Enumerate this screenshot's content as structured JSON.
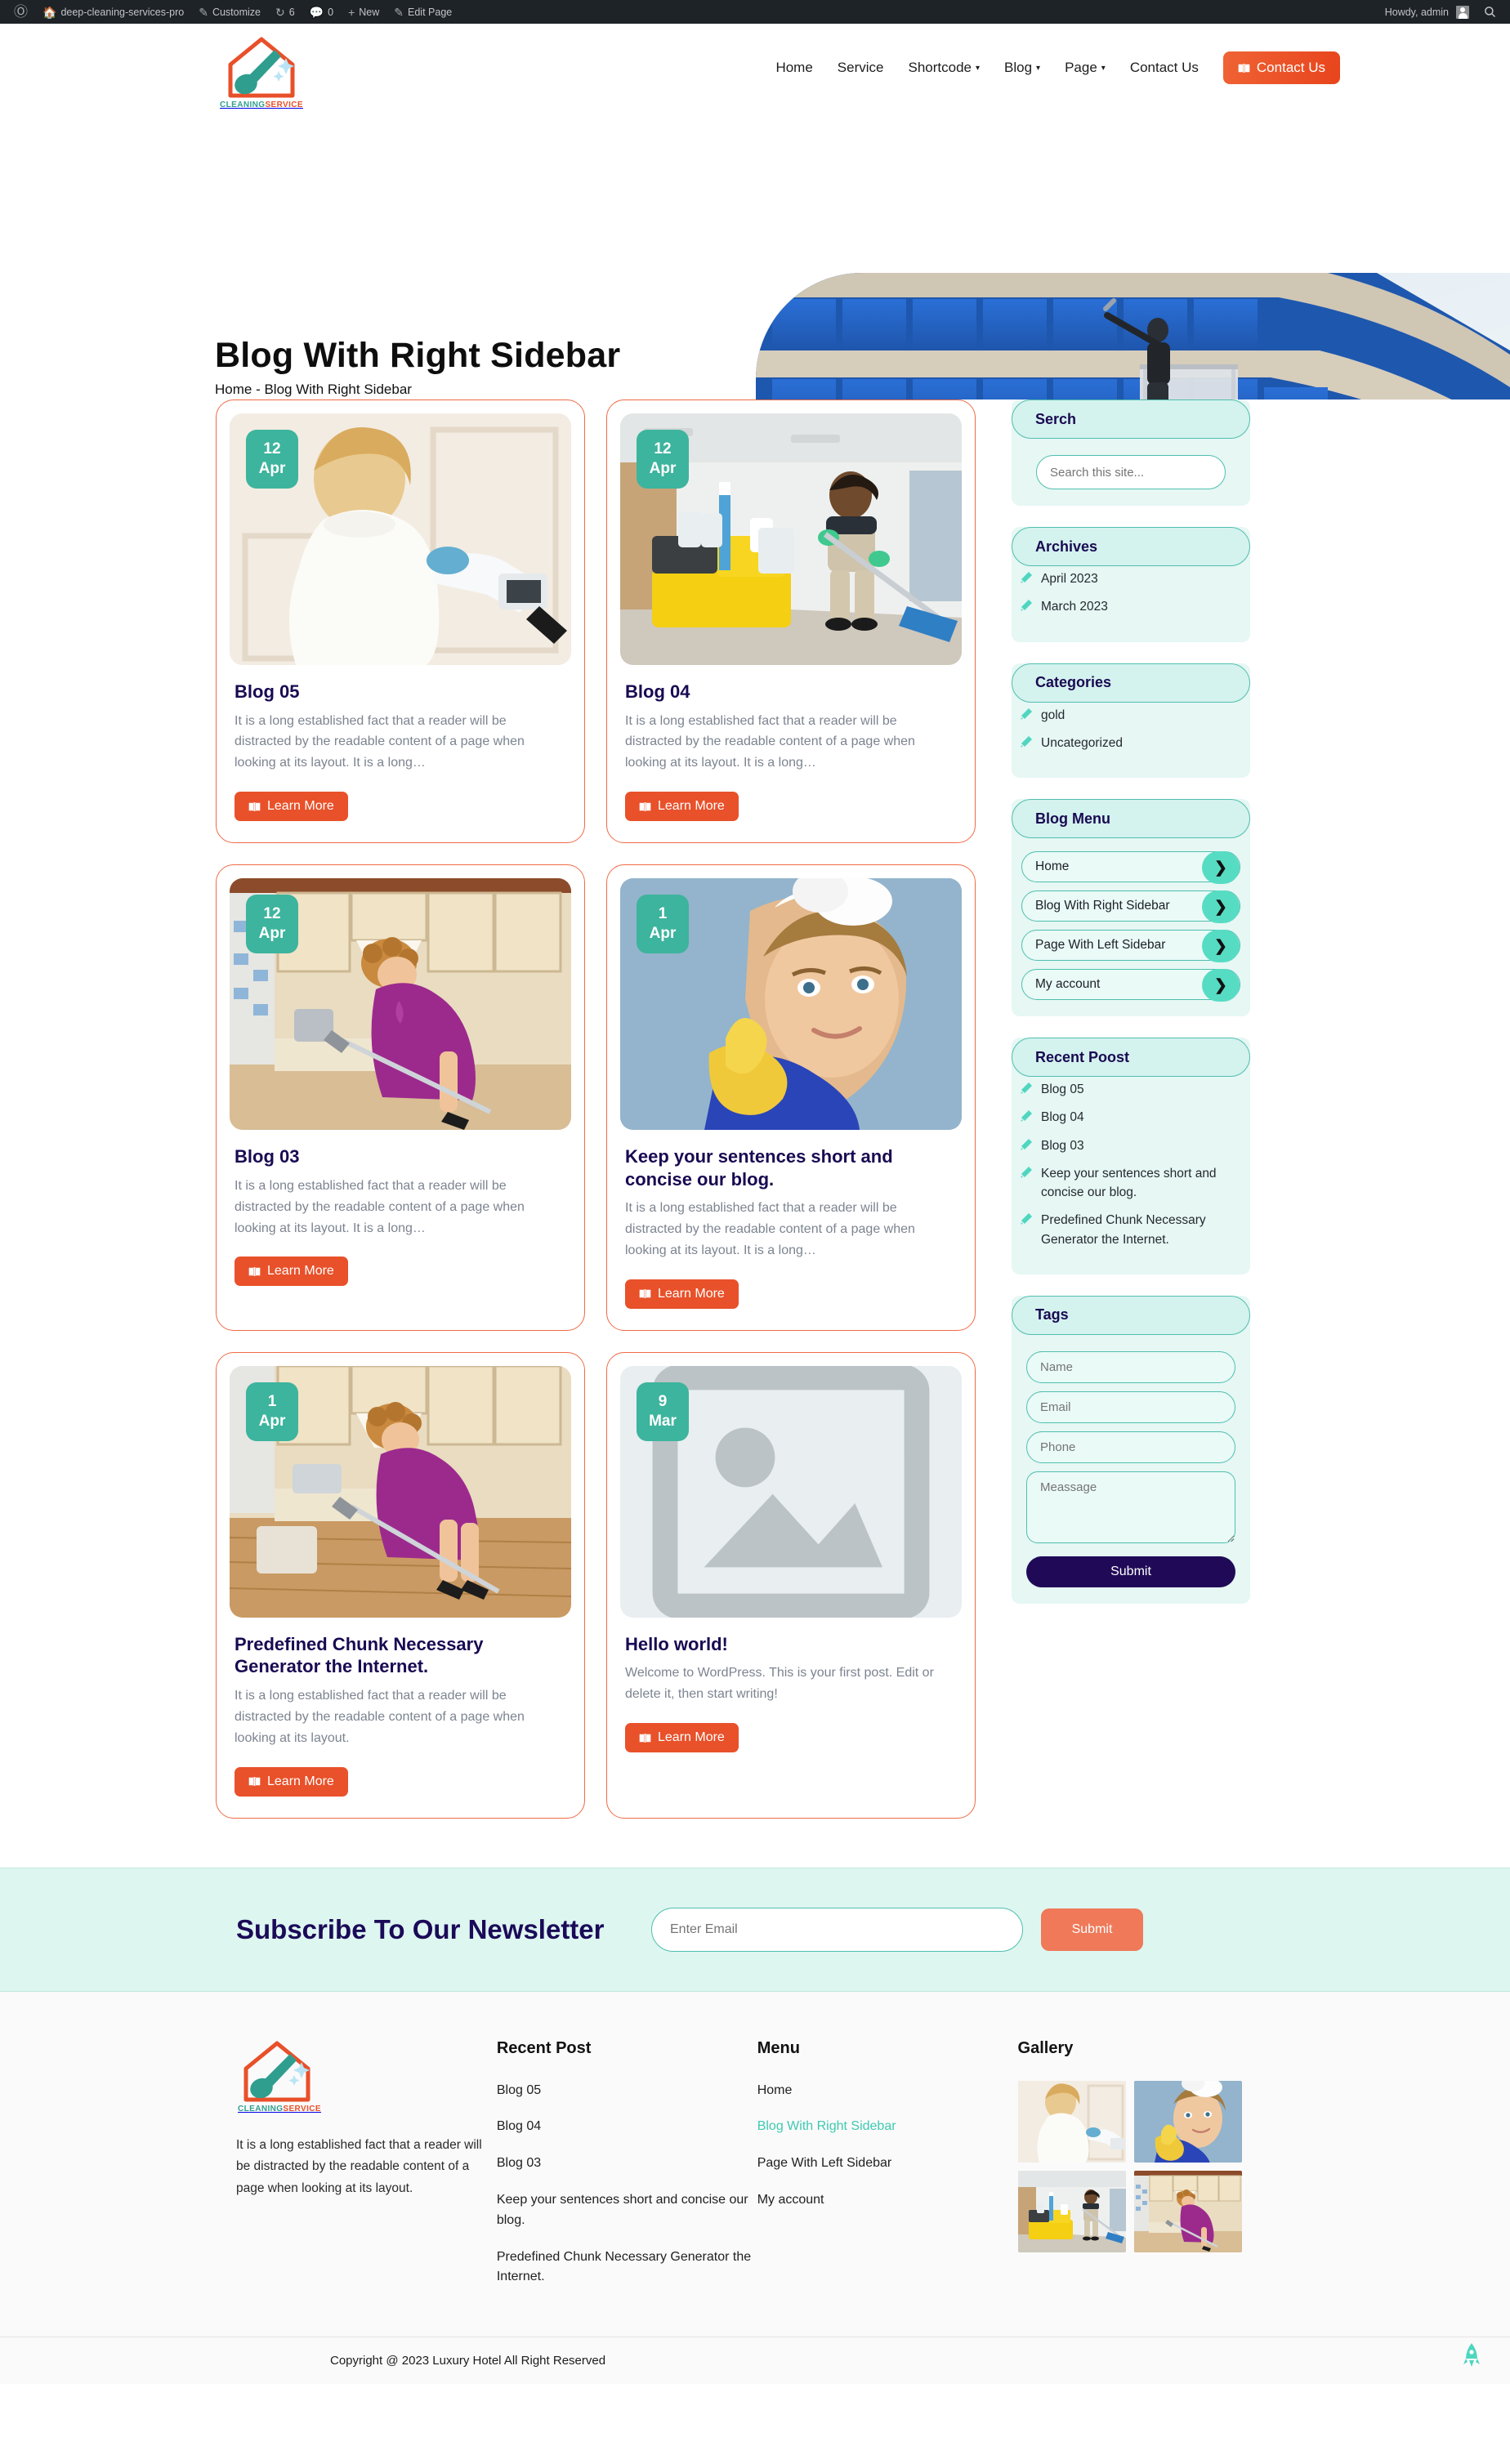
{
  "adminbar": {
    "site_name": "deep-cleaning-services-pro",
    "customize": "Customize",
    "updates_count": "6",
    "comments_count": "0",
    "new": "New",
    "edit_page": "Edit Page",
    "howdy": "Howdy, admin"
  },
  "brand": {
    "line1": "CLEANING",
    "line2": "SERVICE"
  },
  "nav": {
    "items": [
      {
        "label": "Home",
        "caret": false
      },
      {
        "label": "Service",
        "caret": false
      },
      {
        "label": "Shortcode",
        "caret": true
      },
      {
        "label": "Blog",
        "caret": true
      },
      {
        "label": "Page",
        "caret": true
      },
      {
        "label": "Contact Us",
        "caret": false
      }
    ],
    "cta": "Contact Us"
  },
  "hero": {
    "title": "Blog With Right Sidebar",
    "breadcrumb": "Home -  Blog With Right Sidebar"
  },
  "posts": [
    {
      "day": "12",
      "month": "Apr",
      "title": "Blog 05",
      "excerpt": "It is a long established fact that a reader will be distracted by the readable content of a page when looking at its layout. It is a long…",
      "cta": "Learn More",
      "image": "woman-white-dress-vacuum"
    },
    {
      "day": "12",
      "month": "Apr",
      "title": "Blog 04",
      "excerpt": "It is a long established fact that a reader will be distracted by the readable content of a page when looking at its layout. It is a long…",
      "cta": "Learn More",
      "image": "janitor-mopping-corridor"
    },
    {
      "day": "12",
      "month": "Apr",
      "title": "Blog 03",
      "excerpt": "It is a long established fact that a reader will be distracted by the readable content of a page when looking at its layout. It is a long…",
      "cta": "Learn More",
      "image": "woman-purple-dress-kitchen"
    },
    {
      "day": "1",
      "month": "Apr",
      "title": "Keep your sentences short and concise our blog.",
      "excerpt": "It is a long established fact that a reader will be distracted by the readable content of a page when looking at its layout. It is a long…",
      "cta": "Learn More",
      "image": "woman-yellow-glove-thumbsup"
    },
    {
      "day": "1",
      "month": "Apr",
      "title": "Predefined Chunk Necessary Generator the Internet.",
      "excerpt": "It is a long established fact that a reader will be distracted by the readable content of a page when looking at its layout.",
      "cta": "Learn More",
      "image": "woman-mopping-kitchen-floor"
    },
    {
      "day": "9",
      "month": "Mar",
      "title": "Hello world!",
      "excerpt": "Welcome to WordPress. This is your first post. Edit or delete it, then start writing!",
      "cta": "Learn More",
      "image": "placeholder"
    }
  ],
  "sidebar": {
    "search": {
      "heading": "Serch",
      "placeholder": "Search this site...",
      "value": ""
    },
    "archives": {
      "heading": "Archives",
      "items": [
        "April 2023",
        "March 2023"
      ]
    },
    "categories": {
      "heading": "Categories",
      "items": [
        "gold",
        "Uncategorized"
      ]
    },
    "blog_menu": {
      "heading": "Blog Menu",
      "items": [
        "Home",
        "Blog With Right Sidebar",
        "Page With Left Sidebar",
        "My account"
      ]
    },
    "recent": {
      "heading": "Recent Poost",
      "items": [
        "Blog 05",
        "Blog 04",
        "Blog 03",
        "Keep your sentences short and concise our blog.",
        "Predefined Chunk Necessary Generator the Internet."
      ]
    },
    "tags": {
      "heading": "Tags",
      "name_placeholder": "Name",
      "email_placeholder": "Email",
      "phone_placeholder": "Phone",
      "message_placeholder": "Meassage",
      "submit": "Submit"
    }
  },
  "newsletter": {
    "title": "Subscribe To Our Newsletter",
    "placeholder": "Enter Email",
    "submit": "Submit"
  },
  "footer": {
    "about": "It is a long established fact that a reader will be distracted by the readable content of a page when looking at its layout.",
    "recent_post": {
      "heading": "Recent Post",
      "items": [
        "Blog 05",
        "Blog 04",
        "Blog 03",
        "Keep your sentences short and concise our blog.",
        "Predefined Chunk Necessary Generator the Internet."
      ]
    },
    "menu": {
      "heading": "Menu",
      "items": [
        {
          "label": "Home",
          "active": false
        },
        {
          "label": "Blog With Right Sidebar",
          "active": true
        },
        {
          "label": "Page With Left Sidebar",
          "active": false
        },
        {
          "label": "My account",
          "active": false
        }
      ]
    },
    "gallery": {
      "heading": "Gallery"
    },
    "copyright": "Copyright @ 2023 Luxury Hotel All Right Reserved"
  },
  "colors": {
    "orange": "#e8512a",
    "teal": "#3db49d",
    "mint": "#4fd6c0",
    "navy": "#190a52",
    "widget_bg": "#e6f7f4",
    "newsletter_bg": "#ddf6f0"
  }
}
